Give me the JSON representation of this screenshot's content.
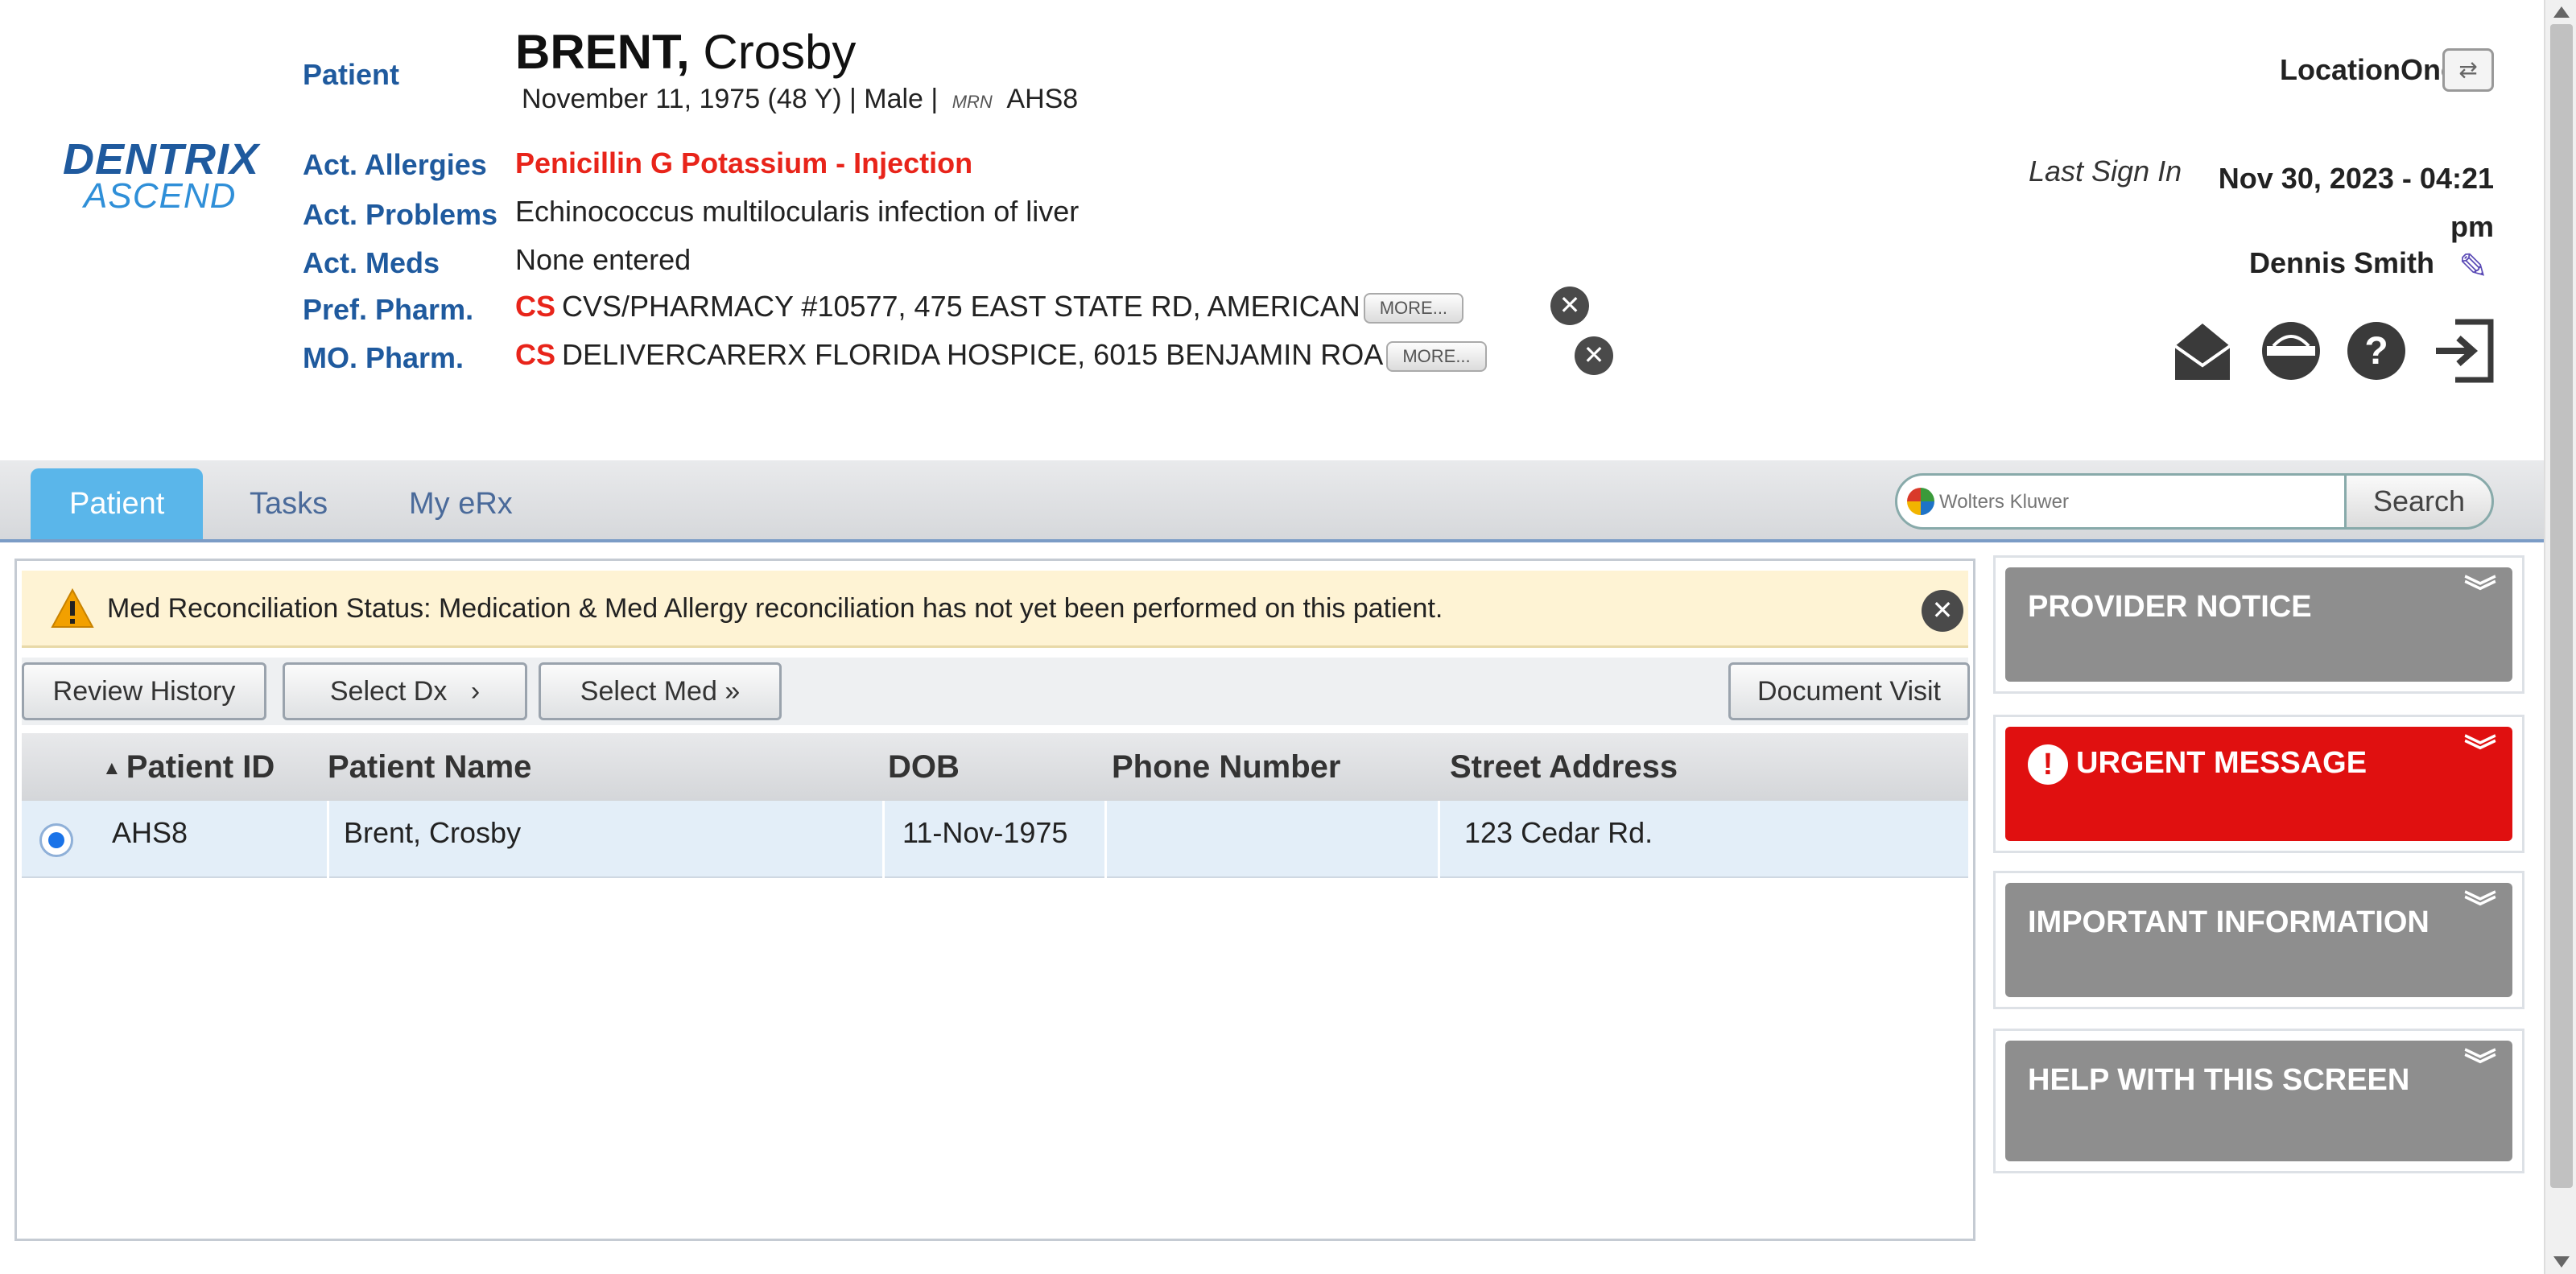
{
  "brand": {
    "line1": "DENTRIX",
    "line2": "ASCEND"
  },
  "patient_header": {
    "patient_label": "Patient",
    "last_name": "BRENT,",
    "first_name": "Crosby",
    "demographics": "November 11, 1975 (48 Y) | Male",
    "mrn_separator": "|",
    "mrn_label": "MRN",
    "mrn": "AHS8",
    "allergies_label": "Act. Allergies",
    "allergies": "Penicillin G Potassium - Injection",
    "problems_label": "Act. Problems",
    "problems": "Echinococcus multilocularis infection of liver",
    "meds_label": "Act. Meds",
    "meds": "None entered",
    "pref_pharm_label": "Pref. Pharm.",
    "pref_pharm_cs": "CS",
    "pref_pharm": "CVS/PHARMACY #10577, 475 EAST STATE RD, AMERICAN",
    "mo_pharm_label": "MO. Pharm.",
    "mo_pharm_cs": "CS",
    "mo_pharm": "DELIVERCARERX FLORIDA HOSPICE, 6015 BENJAMIN ROA",
    "more_label": "MORE..."
  },
  "user_panel": {
    "location": "LocationOne",
    "last_sign_label": "Last Sign In",
    "last_sign_value": "Nov 30, 2023 - 04:21 pm",
    "user_name": "Dennis Smith"
  },
  "tabs": [
    {
      "label": "Patient",
      "active": true
    },
    {
      "label": "Tasks",
      "active": false
    },
    {
      "label": "My eRx",
      "active": false
    }
  ],
  "search": {
    "placeholder": "Wolters Kluwer",
    "button": "Search"
  },
  "alert": {
    "message": "Med Reconciliation Status: Medication & Med Allergy reconciliation has not yet been performed on this patient."
  },
  "toolbar": {
    "review_history": "Review History",
    "select_dx": "Select Dx",
    "select_med": "Select Med",
    "document_visit": "Document Visit"
  },
  "grid": {
    "columns": [
      "Patient ID",
      "Patient Name",
      "DOB",
      "Phone Number",
      "Street Address"
    ],
    "rows": [
      {
        "patient_id": "AHS8",
        "patient_name": "Brent, Crosby",
        "dob": "11-Nov-1975",
        "phone": "",
        "address": "123 Cedar Rd."
      }
    ]
  },
  "side_panels": [
    {
      "title": "PROVIDER NOTICE",
      "style": "gray"
    },
    {
      "title": "URGENT MESSAGE",
      "style": "red"
    },
    {
      "title": "IMPORTANT INFORMATION",
      "style": "gray"
    },
    {
      "title": "HELP WITH THIS SCREEN",
      "style": "gray"
    }
  ],
  "colors": {
    "label_blue": "#1f5a9e",
    "alert_red": "#e8241a",
    "tab_active": "#5ab6ea",
    "urgent_red": "#e01010",
    "panel_gray": "#8e8e8e"
  },
  "icons": [
    "mail-icon",
    "help-desk-icon",
    "help-icon",
    "logout-icon",
    "pencil-icon",
    "warning-icon",
    "close-icon",
    "switch-location-icon"
  ]
}
